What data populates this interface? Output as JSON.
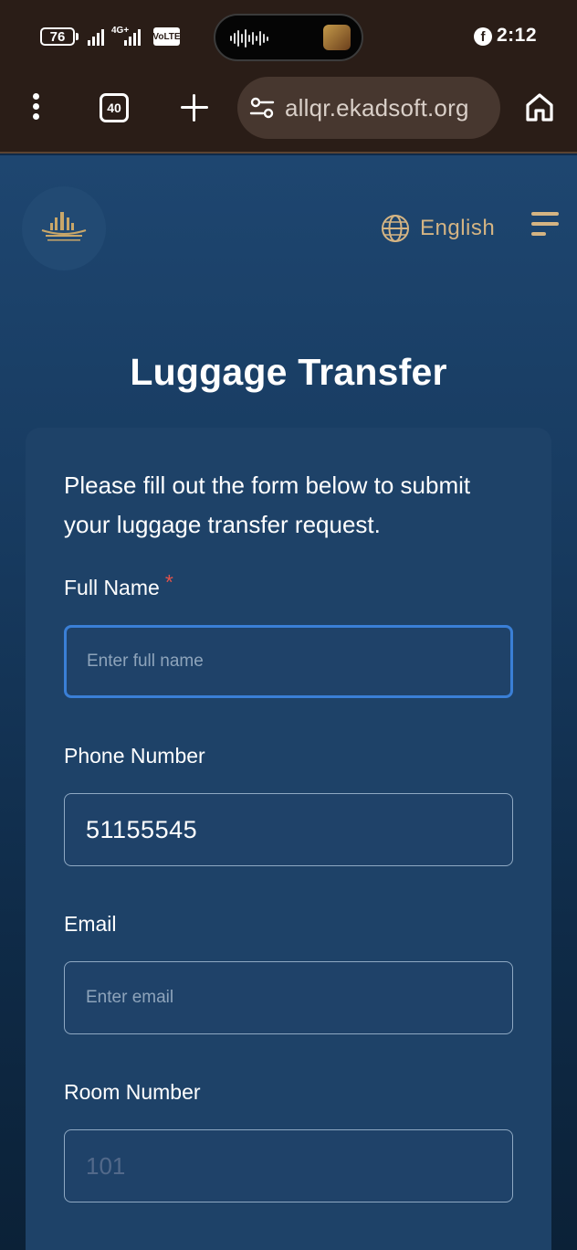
{
  "status_bar": {
    "battery": "76",
    "network": "4G+",
    "volte": "VoLTE",
    "time": "2:12",
    "notification_app": "f"
  },
  "browser": {
    "tab_count": "40",
    "url": "allqr.ekadsoft.org"
  },
  "header": {
    "language_label": "English"
  },
  "page": {
    "title": "Luggage Transfer",
    "intro": "Please fill out the form below to submit your luggage transfer request."
  },
  "form": {
    "full_name": {
      "label": "Full Name",
      "required_mark": "*",
      "placeholder": "Enter full name",
      "value": ""
    },
    "phone": {
      "label": "Phone Number",
      "value": "51155545"
    },
    "email": {
      "label": "Email",
      "placeholder": "Enter email",
      "value": ""
    },
    "room": {
      "label": "Room Number",
      "placeholder": "101",
      "value": ""
    }
  },
  "colors": {
    "accent_gold": "#d4b483",
    "focus_blue": "#3a7fd6",
    "required_red": "#e0524a",
    "chrome_bg": "#2a1d17"
  }
}
